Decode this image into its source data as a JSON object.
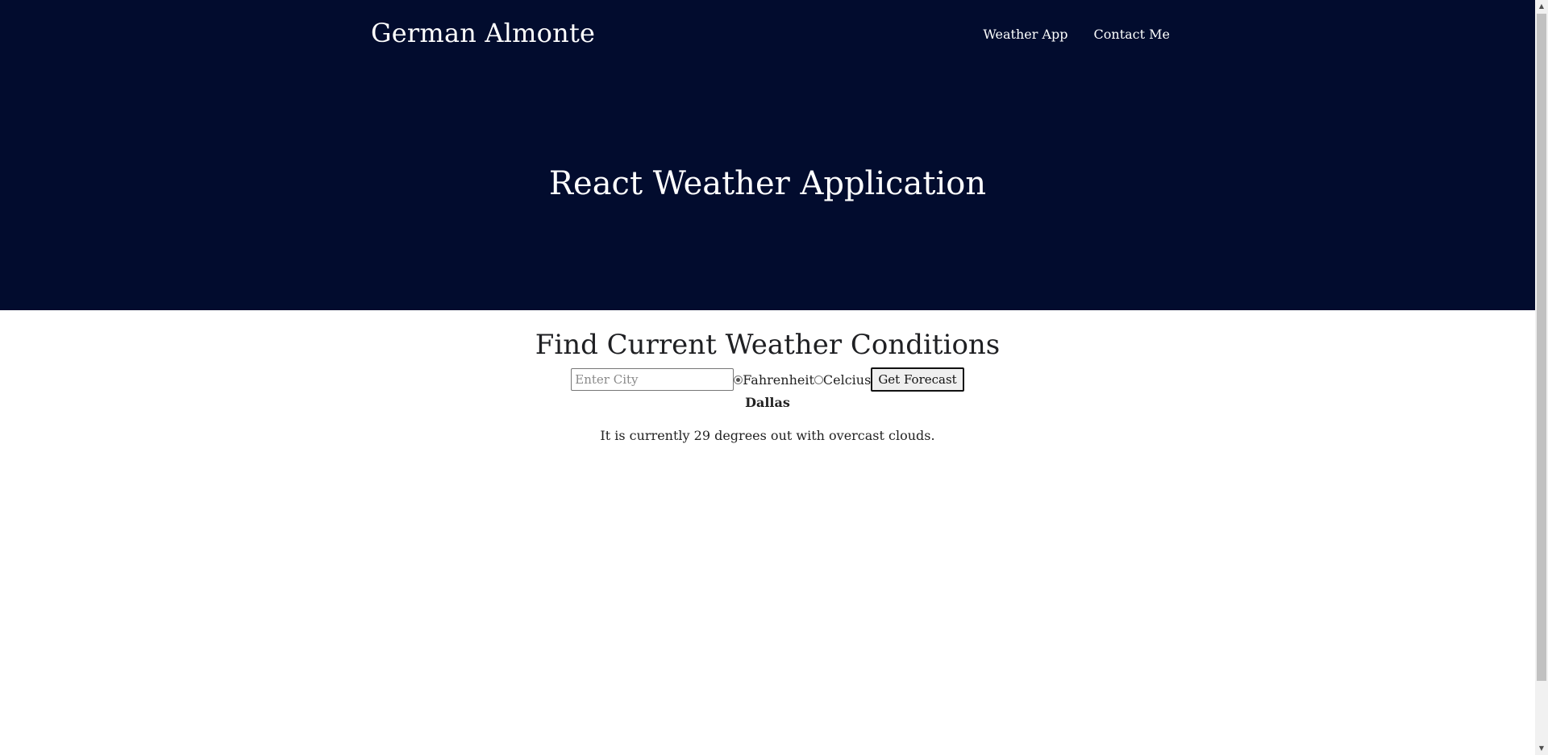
{
  "header": {
    "brand": "German Almonte",
    "nav": [
      {
        "label": "Weather App"
      },
      {
        "label": "Contact Me"
      }
    ],
    "hero_title": "React Weather Application"
  },
  "main": {
    "title": "Find Current Weather Conditions",
    "city_input": {
      "value": "",
      "placeholder": "Enter City"
    },
    "units": [
      {
        "label": "Fahrenheit",
        "checked": true
      },
      {
        "label": "Celcius",
        "checked": false
      }
    ],
    "submit_label": "Get Forecast",
    "result": {
      "city": "Dallas",
      "message": "It is currently 29 degrees out with overcast clouds."
    }
  },
  "colors": {
    "header_bg": "#020c2e",
    "header_text": "#ffffff",
    "body_text": "#222222"
  },
  "icons": {
    "scroll_up": "scroll-up-arrow-icon",
    "scroll_down": "scroll-down-arrow-icon"
  }
}
